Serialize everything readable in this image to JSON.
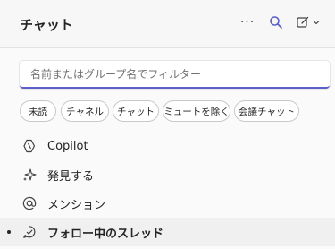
{
  "header": {
    "title": "チャット",
    "more_label": "···",
    "accent": "#5b5fc7"
  },
  "search": {
    "placeholder": "名前またはグループ名でフィルター",
    "value": ""
  },
  "filters": [
    "未読",
    "チャネル",
    "チャット",
    "ミュートを除く",
    "会議チャット"
  ],
  "nav": {
    "items": [
      {
        "label": "Copilot",
        "icon": "copilot-icon"
      },
      {
        "label": "発見する",
        "icon": "sparkle-icon"
      },
      {
        "label": "メンション",
        "icon": "at-icon"
      },
      {
        "label": "フォロー中のスレッド",
        "icon": "followed-threads-icon",
        "active": true
      }
    ]
  }
}
